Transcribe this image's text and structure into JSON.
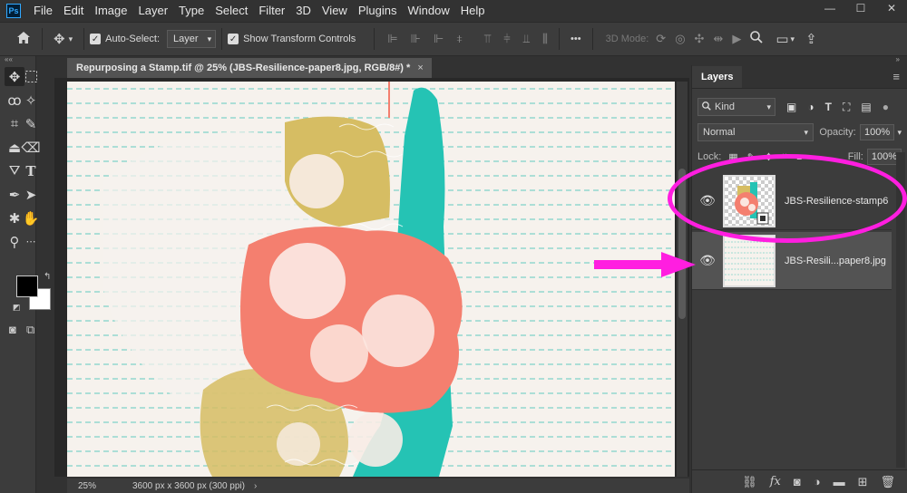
{
  "menubar": {
    "logo": "Ps",
    "items": [
      "File",
      "Edit",
      "Image",
      "Layer",
      "Type",
      "Select",
      "Filter",
      "3D",
      "View",
      "Plugins",
      "Window",
      "Help"
    ],
    "window_controls": [
      "—",
      "☐",
      "✕"
    ]
  },
  "options": {
    "auto_select_label": "Auto-Select:",
    "auto_select_value": "Layer",
    "show_transform_label": "Show Transform Controls",
    "more_label": "•••",
    "mode_label": "3D Mode:"
  },
  "document": {
    "tab_title": "Repurposing a Stamp.tif @ 25% (JBS-Resilience-paper8.jpg, RGB/8#) *",
    "tab_close": "×",
    "zoom": "25%",
    "info": "3600 px x 3600 px (300 ppi)",
    "info_arrow": "›"
  },
  "layers_panel": {
    "tab_label": "Layers",
    "kind_value": "Kind",
    "blend_mode": "Normal",
    "opacity_label": "Opacity:",
    "opacity_value": "100%",
    "lock_label": "Lock:",
    "fill_label": "Fill:",
    "fill_value": "100%",
    "layers": [
      {
        "name": "JBS-Resilience-stamp6",
        "visible": true,
        "selected": false
      },
      {
        "name": "JBS-Resili...paper8.jpg",
        "visible": true,
        "selected": true
      }
    ]
  },
  "colors": {
    "accent": "#ff1ee0",
    "foreground": "#000000",
    "background": "#ffffff"
  }
}
